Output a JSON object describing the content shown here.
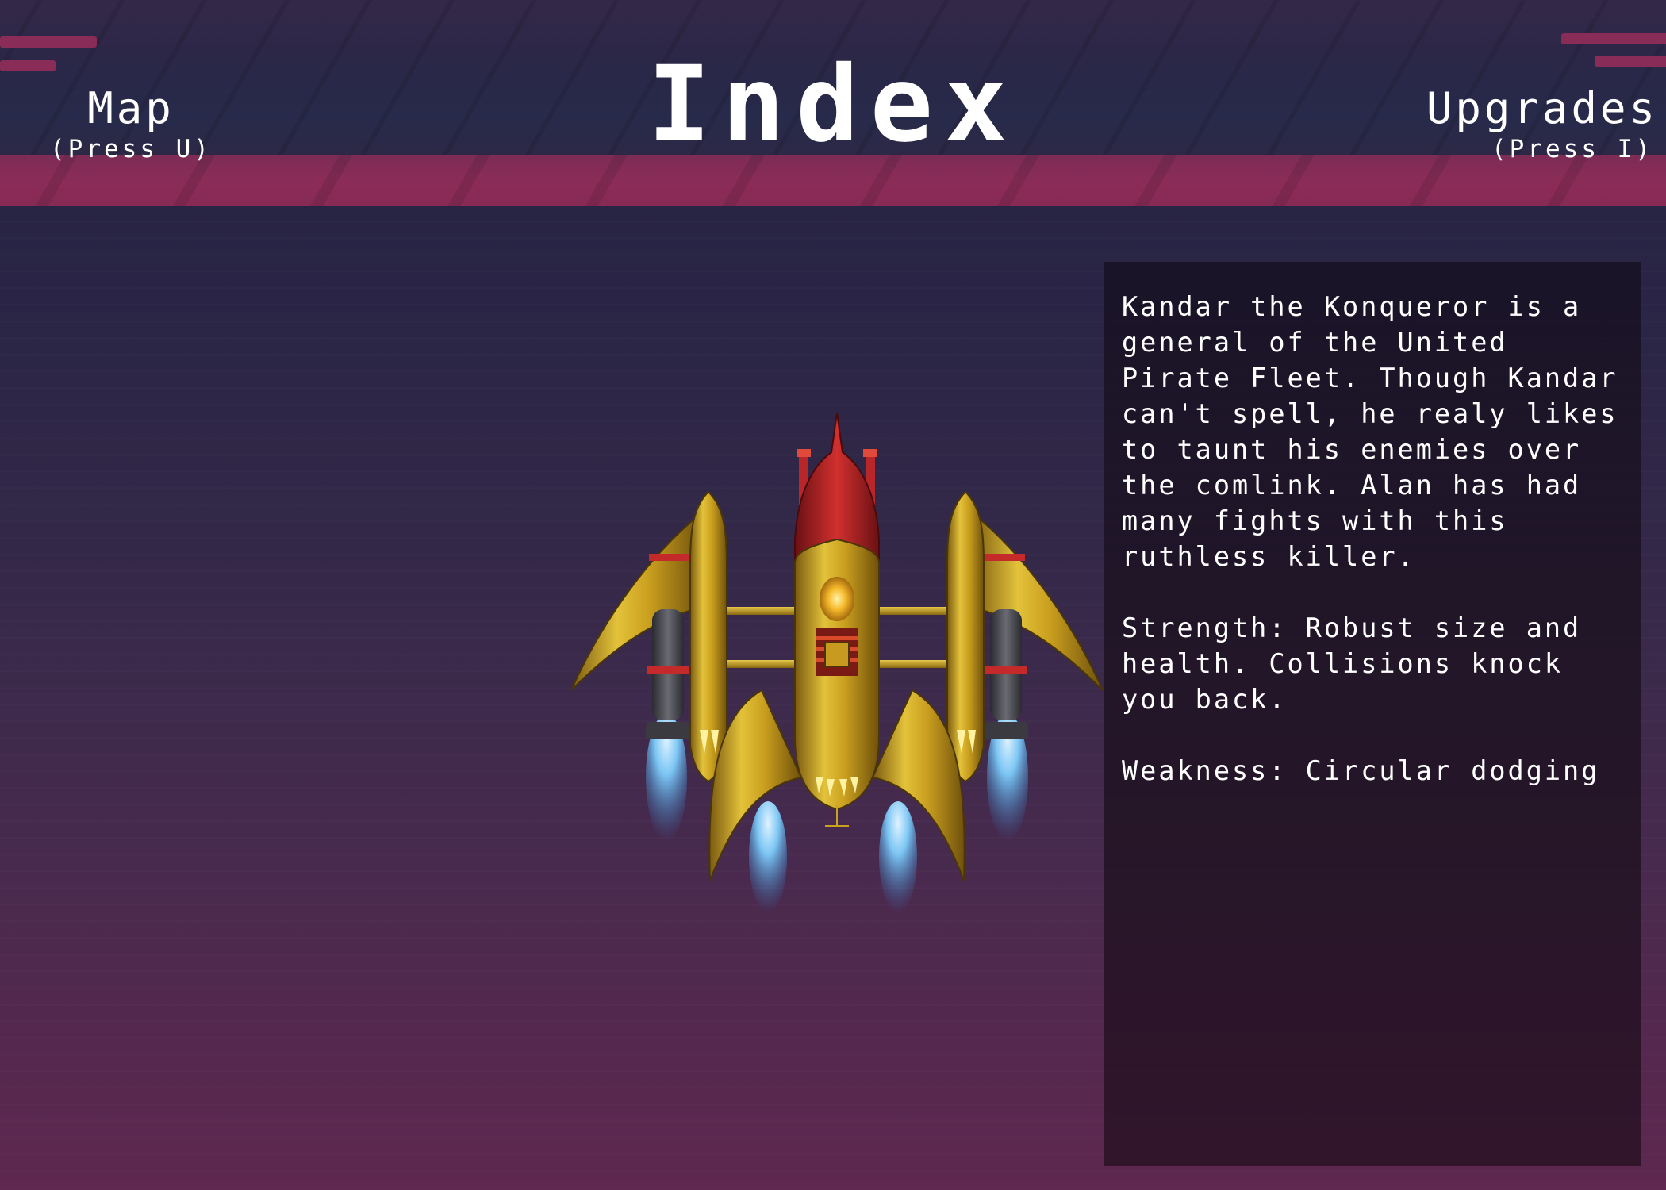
{
  "header": {
    "title": "Index",
    "nav_left": {
      "label": "Map",
      "hint": "(Press U)"
    },
    "nav_right": {
      "label": "Upgrades",
      "hint": "(Press I)"
    }
  },
  "entry": {
    "ship_icon": "golden-pirate-warship-sprite",
    "description": "Kandar the Konqueror is a general of the United Pirate Fleet. Though Kandar can't spell, he realy likes to taunt his enemies over the comlink. Alan has had many fights with this ruthless killer.",
    "strength": "Strength: Robust size and health. Collisions knock you back.",
    "weakness": "Weakness: Circular dodging"
  },
  "colors": {
    "header_band": "#8b2c58",
    "panel_bg": "#1c121e",
    "text": "#ffffff",
    "ship_gold": "#c9a21e",
    "ship_red": "#b8262a",
    "thruster_blue": "#4aa3e8"
  }
}
